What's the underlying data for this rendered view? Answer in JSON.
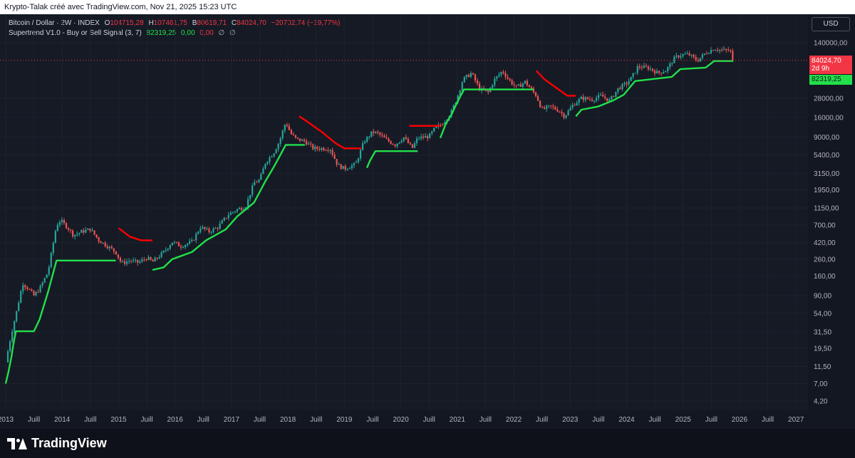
{
  "header": {
    "caption": "Krypto-Talak créé avec TradingView.com, Nov 21, 2025 15:23 UTC"
  },
  "legend": {
    "symbol": "Bitcoin / Dollar · 2W · INDEX",
    "open_label": "O",
    "open": "104715,28",
    "high_label": "H",
    "high": "107461,75",
    "low_label": "B",
    "low": "80619,71",
    "close_label": "C",
    "close": "84024,70",
    "change": "−20702,74 (−19,77%)",
    "indicator": "Supertrend V1.0 - Buy or Sell Signal (3, 7)",
    "ind_value": "82319,25",
    "ind_v2": "0,00",
    "ind_v3": "0,00",
    "ind_v4": "∅",
    "ind_v5": "∅"
  },
  "axis": {
    "currency": "USD",
    "last_price": "84024,70",
    "countdown": "2d 9h",
    "supertrend_price": "82319,25"
  },
  "footer": {
    "brand": "TradingView"
  },
  "colors": {
    "background": "#161a25",
    "up": "#22e04a",
    "down": "#f23645",
    "supertrend_up": "#22e04a",
    "supertrend_down": "#ff0000",
    "candle_up": "#26a69a",
    "candle_down": "#ef5350"
  },
  "chart_data": {
    "type": "candlestick",
    "y_scale": "log",
    "ylim": [
      3.5,
      250000
    ],
    "y_ticks": [
      {
        "value": 140000,
        "label": "140000,00"
      },
      {
        "value": 28000,
        "label": "28000,00"
      },
      {
        "value": 16000,
        "label": "16000,00"
      },
      {
        "value": 9000,
        "label": "9000,00"
      },
      {
        "value": 5400,
        "label": "5400,00"
      },
      {
        "value": 3150,
        "label": "3150,00"
      },
      {
        "value": 1950,
        "label": "1950,00"
      },
      {
        "value": 1150,
        "label": "1150,00"
      },
      {
        "value": 700,
        "label": "700,00"
      },
      {
        "value": 420,
        "label": "420,00"
      },
      {
        "value": 260,
        "label": "260,00"
      },
      {
        "value": 160,
        "label": "160,00"
      },
      {
        "value": 90,
        "label": "90,00"
      },
      {
        "value": 54,
        "label": "54,00"
      },
      {
        "value": 31.5,
        "label": "31,50"
      },
      {
        "value": 19.5,
        "label": "19,50"
      },
      {
        "value": 11.5,
        "label": "11,50"
      },
      {
        "value": 7,
        "label": "7,00"
      },
      {
        "value": 4.2,
        "label": "4,20"
      }
    ],
    "xlim": [
      2013.0,
      2027.2
    ],
    "x_ticks": [
      {
        "value": 2013.0,
        "label": "2013"
      },
      {
        "value": 2013.5,
        "label": "Juill"
      },
      {
        "value": 2014.0,
        "label": "2014"
      },
      {
        "value": 2014.5,
        "label": "Juill"
      },
      {
        "value": 2015.0,
        "label": "2015"
      },
      {
        "value": 2015.5,
        "label": "Juill"
      },
      {
        "value": 2016.0,
        "label": "2016"
      },
      {
        "value": 2016.5,
        "label": "Juill"
      },
      {
        "value": 2017.0,
        "label": "2017"
      },
      {
        "value": 2017.5,
        "label": "Juill"
      },
      {
        "value": 2018.0,
        "label": "2018"
      },
      {
        "value": 2018.5,
        "label": "Juill"
      },
      {
        "value": 2019.0,
        "label": "2019"
      },
      {
        "value": 2019.5,
        "label": "Juill"
      },
      {
        "value": 2020.0,
        "label": "2020"
      },
      {
        "value": 2020.5,
        "label": "Juill"
      },
      {
        "value": 2021.0,
        "label": "2021"
      },
      {
        "value": 2021.5,
        "label": "Juill"
      },
      {
        "value": 2022.0,
        "label": "2022"
      },
      {
        "value": 2022.5,
        "label": "Juill"
      },
      {
        "value": 2023.0,
        "label": "2023"
      },
      {
        "value": 2023.5,
        "label": "Juill"
      },
      {
        "value": 2024.0,
        "label": "2024"
      },
      {
        "value": 2024.5,
        "label": "Juill"
      },
      {
        "value": 2025.0,
        "label": "2025"
      },
      {
        "value": 2025.5,
        "label": "Juill"
      },
      {
        "value": 2026.0,
        "label": "2026"
      },
      {
        "value": 2026.5,
        "label": "Juill"
      },
      {
        "value": 2027.0,
        "label": "2027"
      }
    ],
    "price_path": [
      [
        2013.0,
        13
      ],
      [
        2013.1,
        30
      ],
      [
        2013.2,
        60
      ],
      [
        2013.3,
        130
      ],
      [
        2013.4,
        110
      ],
      [
        2013.5,
        90
      ],
      [
        2013.6,
        110
      ],
      [
        2013.75,
        180
      ],
      [
        2013.9,
        700
      ],
      [
        2013.97,
        800
      ],
      [
        2014.1,
        650
      ],
      [
        2014.2,
        520
      ],
      [
        2014.35,
        580
      ],
      [
        2014.5,
        620
      ],
      [
        2014.65,
        450
      ],
      [
        2014.8,
        380
      ],
      [
        2014.95,
        320
      ],
      [
        2015.05,
        230
      ],
      [
        2015.2,
        250
      ],
      [
        2015.35,
        235
      ],
      [
        2015.5,
        270
      ],
      [
        2015.6,
        240
      ],
      [
        2015.8,
        320
      ],
      [
        2015.95,
        430
      ],
      [
        2016.1,
        380
      ],
      [
        2016.3,
        430
      ],
      [
        2016.45,
        660
      ],
      [
        2016.6,
        580
      ],
      [
        2016.75,
        650
      ],
      [
        2016.95,
        960
      ],
      [
        2017.1,
        1100
      ],
      [
        2017.25,
        1200
      ],
      [
        2017.4,
        2400
      ],
      [
        2017.5,
        2600
      ],
      [
        2017.6,
        4300
      ],
      [
        2017.75,
        5800
      ],
      [
        2017.85,
        8000
      ],
      [
        2017.96,
        14000
      ],
      [
        2018.05,
        10000
      ],
      [
        2018.15,
        8500
      ],
      [
        2018.3,
        8000
      ],
      [
        2018.45,
        6500
      ],
      [
        2018.6,
        6500
      ],
      [
        2018.75,
        6400
      ],
      [
        2018.88,
        4000
      ],
      [
        2019.0,
        3600
      ],
      [
        2019.2,
        4100
      ],
      [
        2019.35,
        8000
      ],
      [
        2019.5,
        10500
      ],
      [
        2019.6,
        10000
      ],
      [
        2019.75,
        8300
      ],
      [
        2019.9,
        7200
      ],
      [
        2020.05,
        9000
      ],
      [
        2020.2,
        6500
      ],
      [
        2020.3,
        8800
      ],
      [
        2020.5,
        9200
      ],
      [
        2020.6,
        11500
      ],
      [
        2020.75,
        13500
      ],
      [
        2020.9,
        19000
      ],
      [
        2021.0,
        29000
      ],
      [
        2021.1,
        48000
      ],
      [
        2021.25,
        58000
      ],
      [
        2021.4,
        36000
      ],
      [
        2021.55,
        33000
      ],
      [
        2021.65,
        47000
      ],
      [
        2021.8,
        62000
      ],
      [
        2021.9,
        49000
      ],
      [
        2022.05,
        38000
      ],
      [
        2022.2,
        45000
      ],
      [
        2022.4,
        30000
      ],
      [
        2022.5,
        20000
      ],
      [
        2022.65,
        22000
      ],
      [
        2022.8,
        19500
      ],
      [
        2022.9,
        16500
      ],
      [
        2023.05,
        23000
      ],
      [
        2023.2,
        28000
      ],
      [
        2023.4,
        27000
      ],
      [
        2023.55,
        30000
      ],
      [
        2023.7,
        26000
      ],
      [
        2023.85,
        37000
      ],
      [
        2024.0,
        43000
      ],
      [
        2024.1,
        52000
      ],
      [
        2024.2,
        70000
      ],
      [
        2024.4,
        67000
      ],
      [
        2024.55,
        58000
      ],
      [
        2024.7,
        63000
      ],
      [
        2024.85,
        90000
      ],
      [
        2024.95,
        98000
      ],
      [
        2025.1,
        100000
      ],
      [
        2025.25,
        83000
      ],
      [
        2025.4,
        104000
      ],
      [
        2025.55,
        118000
      ],
      [
        2025.7,
        112000
      ],
      [
        2025.8,
        112000
      ],
      [
        2025.87,
        105000
      ],
      [
        2025.89,
        84024.7
      ]
    ],
    "supertrend_up": [
      [
        [
          2013.0,
          7
        ],
        [
          2013.05,
          10
        ],
        [
          2013.1,
          15
        ],
        [
          2013.15,
          25
        ],
        [
          2013.18,
          32
        ],
        [
          2013.5,
          32
        ],
        [
          2013.6,
          45
        ],
        [
          2013.75,
          100
        ],
        [
          2013.9,
          250
        ],
        [
          2013.97,
          250
        ],
        [
          2014.95,
          250
        ]
      ],
      [
        [
          2015.6,
          190
        ],
        [
          2015.8,
          205
        ],
        [
          2015.95,
          260
        ],
        [
          2016.3,
          320
        ],
        [
          2016.55,
          450
        ],
        [
          2016.9,
          620
        ],
        [
          2017.1,
          900
        ],
        [
          2017.4,
          1350
        ],
        [
          2017.6,
          2500
        ],
        [
          2017.75,
          3800
        ],
        [
          2017.88,
          5600
        ],
        [
          2017.96,
          7200
        ],
        [
          2018.3,
          7200
        ]
      ],
      [
        [
          2019.4,
          3700
        ],
        [
          2019.45,
          4500
        ],
        [
          2019.55,
          6000
        ],
        [
          2020.3,
          6000
        ]
      ],
      [
        [
          2020.7,
          8800
        ],
        [
          2020.8,
          13500
        ],
        [
          2020.9,
          17500
        ],
        [
          2021.0,
          25000
        ],
        [
          2021.12,
          36000
        ],
        [
          2022.35,
          36000
        ]
      ],
      [
        [
          2023.1,
          16500
        ],
        [
          2023.2,
          20000
        ],
        [
          2023.5,
          22000
        ],
        [
          2023.75,
          26000
        ],
        [
          2023.95,
          31000
        ],
        [
          2024.15,
          46000
        ],
        [
          2024.8,
          52000
        ],
        [
          2024.95,
          65000
        ],
        [
          2025.4,
          68000
        ],
        [
          2025.55,
          82319.25
        ],
        [
          2025.89,
          82319.25
        ]
      ]
    ],
    "supertrend_down": [
      [
        [
          2015.0,
          640
        ],
        [
          2015.2,
          500
        ],
        [
          2015.4,
          450
        ],
        [
          2015.6,
          450
        ]
      ],
      [
        [
          2018.2,
          16500
        ],
        [
          2018.35,
          14000
        ],
        [
          2018.6,
          10500
        ],
        [
          2018.85,
          7500
        ],
        [
          2019.0,
          6500
        ],
        [
          2019.3,
          6500
        ]
      ],
      [
        [
          2020.15,
          12500
        ],
        [
          2020.7,
          12500
        ]
      ],
      [
        [
          2022.4,
          62000
        ],
        [
          2022.55,
          48000
        ],
        [
          2022.75,
          38000
        ],
        [
          2022.95,
          30000
        ],
        [
          2023.1,
          30000
        ]
      ]
    ]
  }
}
